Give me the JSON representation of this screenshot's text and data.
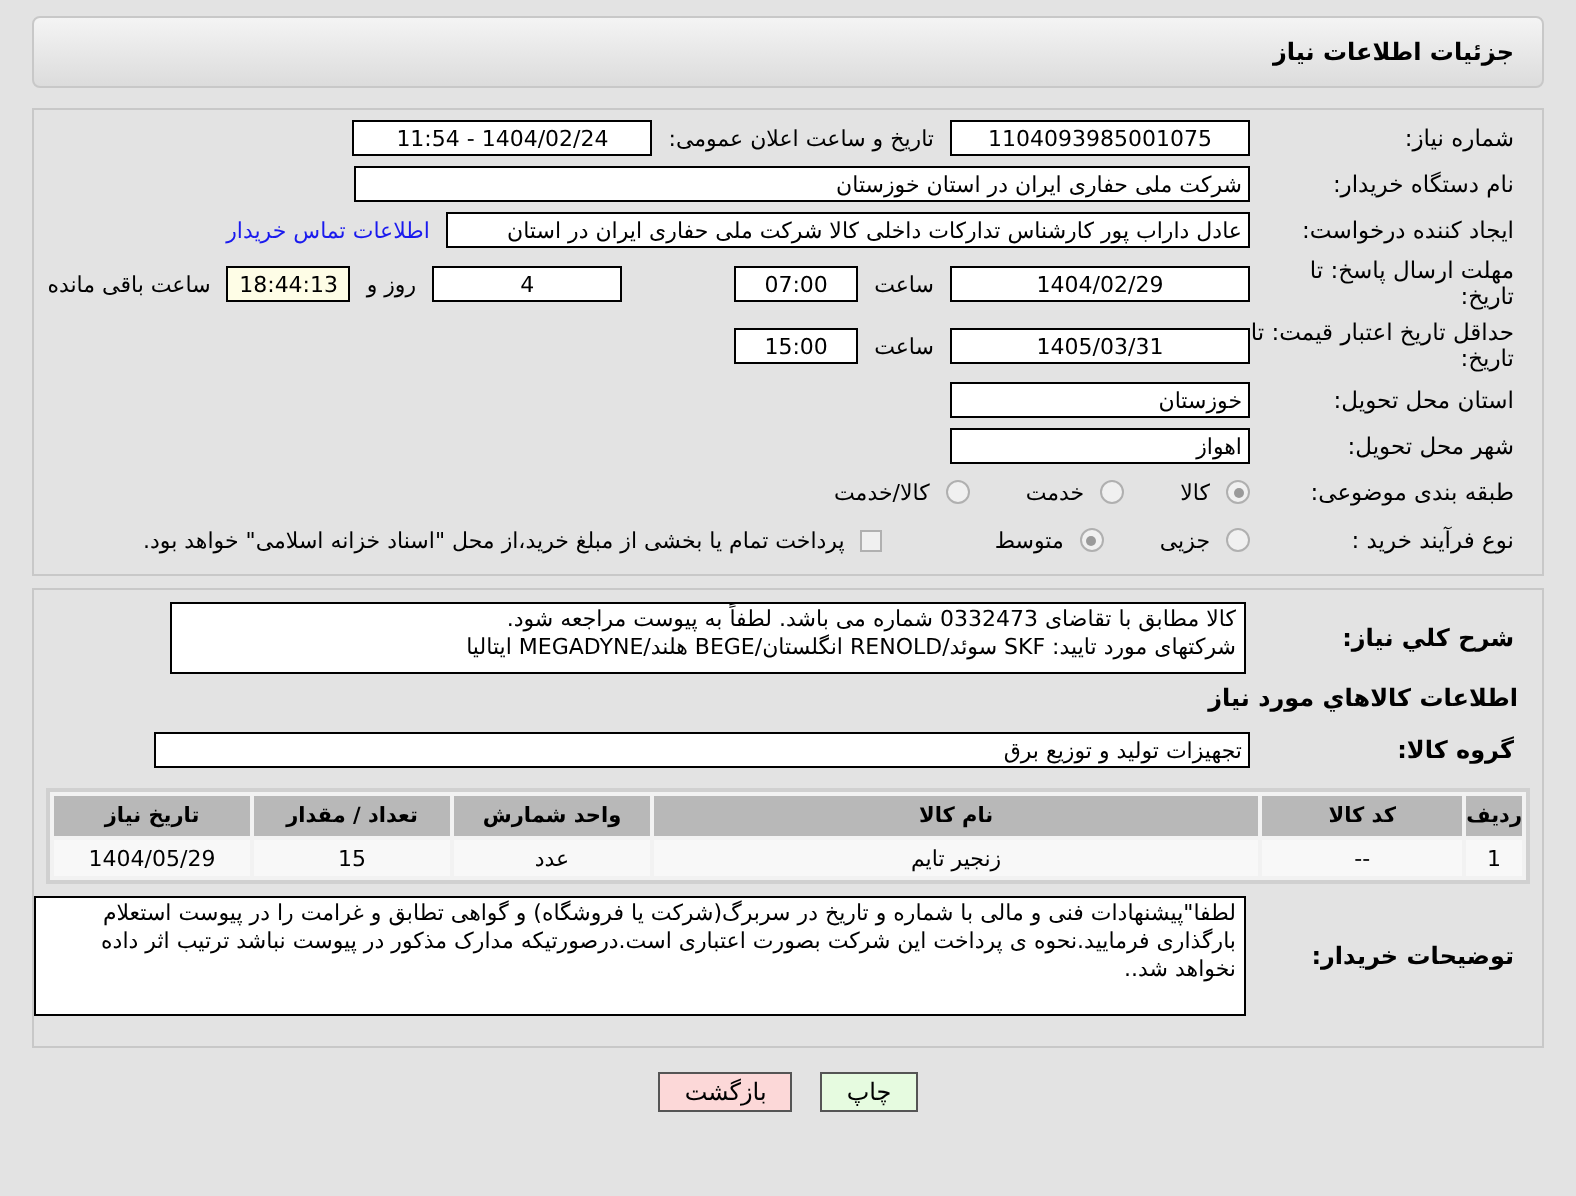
{
  "header": {
    "title": "جزئیات اطلاعات نیاز"
  },
  "need_number": {
    "label": "شماره نیاز:",
    "value": "1104093985001075"
  },
  "announce": {
    "label": "تاریخ و ساعت اعلان عمومی:",
    "value": "1404/02/24 - 11:54"
  },
  "buyer": {
    "label": "نام دستگاه خریدار:",
    "value": "شرکت ملی حفاری ایران در استان خوزستان"
  },
  "requester": {
    "label": "ایجاد کننده درخواست:",
    "value": "عادل داراب پور کارشناس تدارکات داخلی کالا شرکت ملی حفاری ایران در استان",
    "link": "اطلاعات تماس خریدار"
  },
  "deadline": {
    "label": "مهلت ارسال پاسخ: تا تاریخ:",
    "date": "1404/02/29",
    "time_label": "ساعت",
    "time": "07:00",
    "days": "4",
    "days_label": "روز و",
    "remaining": "18:44:13",
    "remaining_label": "ساعت باقی مانده"
  },
  "validity": {
    "label": "حداقل تاریخ اعتبار قیمت: تا تاریخ:",
    "date": "1405/03/31",
    "time_label": "ساعت",
    "time": "15:00"
  },
  "province": {
    "label": "استان محل تحویل:",
    "value": "خوزستان"
  },
  "city": {
    "label": "شهر محل تحویل:",
    "value": "اهواز"
  },
  "category": {
    "label": "طبقه بندی موضوعی:",
    "options": [
      {
        "label": "کالا",
        "selected": true
      },
      {
        "label": "خدمت",
        "selected": false
      },
      {
        "label": "کالا/خدمت",
        "selected": false
      }
    ]
  },
  "purchase_type": {
    "label": "نوع فرآیند خرید :",
    "options": [
      {
        "label": "جزیی",
        "selected": false
      },
      {
        "label": "متوسط",
        "selected": true
      }
    ],
    "payment_note": {
      "label": "پرداخت تمام یا بخشی از مبلغ خرید،از محل \"اسناد خزانه اسلامی\" خواهد بود.",
      "checked": false
    }
  },
  "description": {
    "label": "شرح کلي نياز:",
    "value": "کالا مطابق با تقاضای 0332473 شماره می باشد. لطفاً به پیوست مراجعه شود.\nشرکتهای مورد تایید: SKF سوئد/RENOLD انگلستان/BEGE هلند/MEGADYNE ایتالیا"
  },
  "goods_title": "اطلاعات کالاهاي مورد نياز",
  "goods_group": {
    "label": "گروه کالا:",
    "value": "تجهیزات تولید و توزیع برق"
  },
  "table": {
    "columns": [
      "ردیف",
      "کد کالا",
      "نام کالا",
      "واحد شمارش",
      "تعداد / مقدار",
      "تاریخ نیاز"
    ],
    "rows": [
      [
        "1",
        "--",
        "زنجیر تایم",
        "عدد",
        "15",
        "1404/05/29"
      ]
    ]
  },
  "buyer_notes": {
    "label": "توضیحات خریدار:",
    "value": "لطفا\"پیشنهادات فنی و مالی با شماره و تاریخ در سربرگ(شرکت یا فروشگاه) و گواهی تطابق و غرامت را در پیوست استعلام بارگذاری فرمایید.نحوه ی پرداخت این شرکت بصورت اعتباری است.درصورتیکه مدارک مذکور در پیوست نباشد ترتیب اثر داده نخواهد شد.."
  },
  "buttons": [
    {
      "label": "چاپ",
      "kind": "print"
    },
    {
      "label": "بازگشت",
      "kind": "back"
    }
  ]
}
